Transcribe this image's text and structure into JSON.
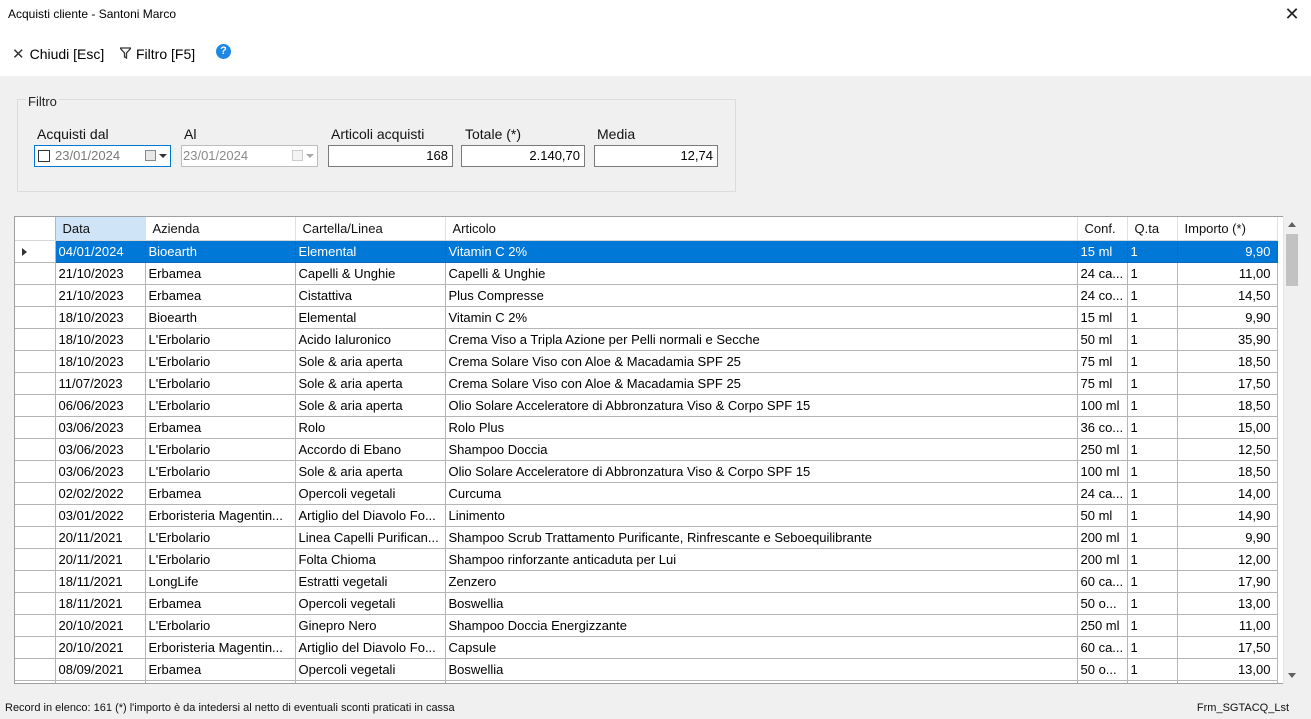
{
  "window": {
    "title": "Acquisti cliente - Santoni Marco"
  },
  "toolbar": {
    "close_label": "Chiudi [Esc]",
    "filter_label": "Filtro [F5]",
    "help_glyph": "?"
  },
  "filter": {
    "title": "Filtro",
    "from_label": "Acquisti dal",
    "from_value": "23/01/2024",
    "to_label": "Al",
    "to_value": "23/01/2024",
    "articles_label": "Articoli acquisti",
    "articles_value": "168",
    "total_label": "Totale (*)",
    "total_value": "2.140,70",
    "average_label": "Media",
    "average_value": "12,74"
  },
  "grid": {
    "columns": [
      "Data",
      "Azienda",
      "Cartella/Linea",
      "Articolo",
      "Conf.",
      "Q.ta",
      "Importo (*)"
    ],
    "rows": [
      [
        "04/01/2024",
        "Bioearth",
        "Elemental",
        "Vitamin C 2%",
        "15 ml",
        "1",
        "9,90"
      ],
      [
        "21/10/2023",
        "Erbamea",
        "Capelli & Unghie",
        "Capelli & Unghie",
        "24 ca...",
        "1",
        "11,00"
      ],
      [
        "21/10/2023",
        "Erbamea",
        "Cistattiva",
        "Plus Compresse",
        "24 co...",
        "1",
        "14,50"
      ],
      [
        "18/10/2023",
        "Bioearth",
        "Elemental",
        "Vitamin C 2%",
        "15 ml",
        "1",
        "9,90"
      ],
      [
        "18/10/2023",
        "L'Erbolario",
        "Acido Ialuronico",
        "Crema Viso a Tripla Azione per Pelli normali e Secche",
        "50 ml",
        "1",
        "35,90"
      ],
      [
        "18/10/2023",
        "L'Erbolario",
        "Sole & aria aperta",
        "Crema Solare Viso con Aloe & Macadamia SPF 25",
        "75 ml",
        "1",
        "18,50"
      ],
      [
        "11/07/2023",
        "L'Erbolario",
        "Sole & aria aperta",
        "Crema Solare Viso con Aloe & Macadamia SPF 25",
        "75 ml",
        "1",
        "17,50"
      ],
      [
        "06/06/2023",
        "L'Erbolario",
        "Sole & aria aperta",
        "Olio Solare Acceleratore di Abbronzatura Viso & Corpo SPF 15",
        "100 ml",
        "1",
        "18,50"
      ],
      [
        "03/06/2023",
        "Erbamea",
        "Rolo",
        "Rolo Plus",
        "36 co...",
        "1",
        "15,00"
      ],
      [
        "03/06/2023",
        "L'Erbolario",
        "Accordo di Ebano",
        "Shampoo Doccia",
        "250 ml",
        "1",
        "12,50"
      ],
      [
        "03/06/2023",
        "L'Erbolario",
        "Sole & aria aperta",
        "Olio Solare Acceleratore di Abbronzatura Viso & Corpo SPF 15",
        "100 ml",
        "1",
        "18,50"
      ],
      [
        "02/02/2022",
        "Erbamea",
        "Opercoli vegetali",
        "Curcuma",
        "24 ca...",
        "1",
        "14,00"
      ],
      [
        "03/01/2022",
        "Erboristeria Magentin...",
        "Artiglio del Diavolo Fo...",
        "Linimento",
        "50 ml",
        "1",
        "14,90"
      ],
      [
        "20/11/2021",
        "L'Erbolario",
        "Linea Capelli Purifican...",
        "Shampoo Scrub Trattamento Purificante, Rinfrescante e Seboequilibrante",
        "200 ml",
        "1",
        "9,90"
      ],
      [
        "20/11/2021",
        "L'Erbolario",
        "Folta Chioma",
        "Shampoo rinforzante anticaduta per Lui",
        "200 ml",
        "1",
        "12,00"
      ],
      [
        "18/11/2021",
        "LongLife",
        "Estratti vegetali",
        "Zenzero",
        "60 ca...",
        "1",
        "17,90"
      ],
      [
        "18/11/2021",
        "Erbamea",
        "Opercoli vegetali",
        "Boswellia",
        "50 o...",
        "1",
        "13,00"
      ],
      [
        "20/10/2021",
        "L'Erbolario",
        "Ginepro Nero",
        "Shampoo Doccia Energizzante",
        "250 ml",
        "1",
        "11,00"
      ],
      [
        "20/10/2021",
        "Erboristeria Magentin...",
        "Artiglio del Diavolo Fo...",
        "Capsule",
        "60 ca...",
        "1",
        "17,50"
      ],
      [
        "08/09/2021",
        "Erbamea",
        "Opercoli vegetali",
        "Boswellia",
        "50 o...",
        "1",
        "13,00"
      ],
      [
        "",
        "",
        "",
        "",
        "",
        "",
        ""
      ]
    ]
  },
  "status": {
    "left": "Record in elenco: 161  (*) l'importo è da intedersi al netto di eventuali sconti praticati in cassa",
    "right": "Frm_SGTACQ_Lst"
  },
  "colors": {
    "selection": "#0078d7",
    "sorted_header": "#cfe5f7",
    "help": "#1e88e5"
  }
}
